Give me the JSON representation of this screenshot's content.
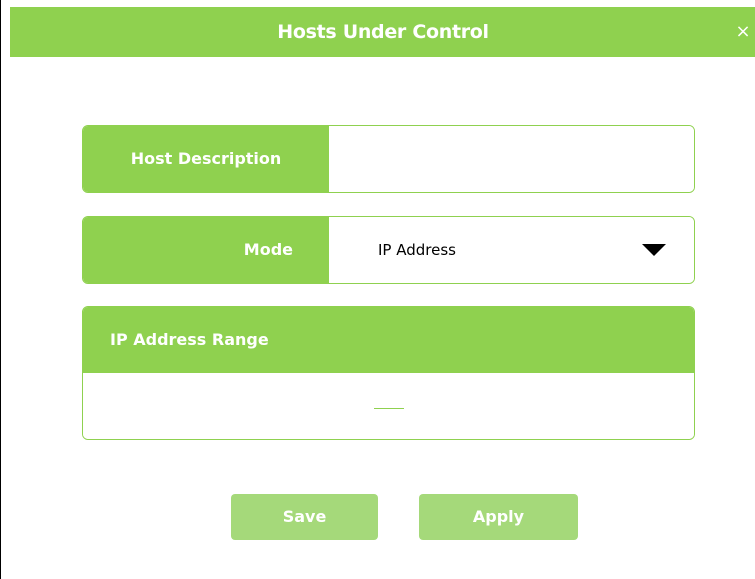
{
  "dialog": {
    "title": "Hosts Under Control",
    "close_icon": "×"
  },
  "form": {
    "host_description": {
      "label": "Host Description",
      "value": ""
    },
    "mode": {
      "label": "Mode",
      "selected": "IP Address"
    },
    "ip_range": {
      "label": "IP Address Range",
      "start_value": "",
      "end_value": ""
    }
  },
  "buttons": {
    "save_label": "Save",
    "apply_label": "Apply"
  },
  "colors": {
    "accent": "#8fd14f",
    "button": "#a5d97a"
  }
}
